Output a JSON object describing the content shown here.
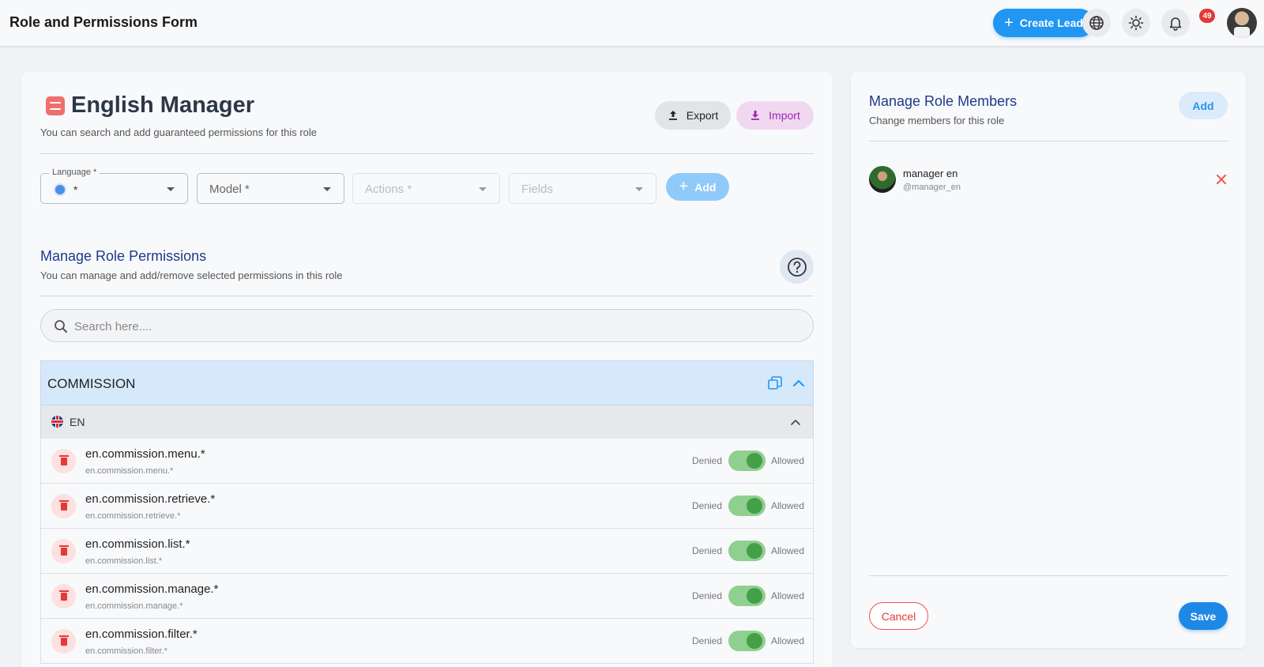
{
  "header": {
    "title": "Role and Permissions Form",
    "create_lead_label": "Create Lead",
    "notification_count": "49"
  },
  "role": {
    "title": "English Manager",
    "subtitle": "You can search and add guaranteed permissions for this role",
    "export_label": "Export",
    "import_label": "Import"
  },
  "filters": {
    "language_label": "Language *",
    "language_value": "*",
    "model_placeholder": "Model *",
    "actions_placeholder": "Actions *",
    "fields_placeholder": "Fields",
    "add_label": "Add"
  },
  "permissions_section": {
    "title": "Manage Role Permissions",
    "subtitle": "You can manage and add/remove selected permissions in this role",
    "search_placeholder": "Search here...."
  },
  "group": {
    "name": "COMMISSION",
    "language": "EN",
    "denied_label": "Denied",
    "allowed_label": "Allowed",
    "items": [
      {
        "name": "en.commission.menu.*",
        "key": "en.commission.menu.*",
        "allowed": true
      },
      {
        "name": "en.commission.retrieve.*",
        "key": "en.commission.retrieve.*",
        "allowed": true
      },
      {
        "name": "en.commission.list.*",
        "key": "en.commission.list.*",
        "allowed": true
      },
      {
        "name": "en.commission.manage.*",
        "key": "en.commission.manage.*",
        "allowed": true
      },
      {
        "name": "en.commission.filter.*",
        "key": "en.commission.filter.*",
        "allowed": true
      }
    ]
  },
  "members": {
    "title": "Manage Role Members",
    "subtitle": "Change members for this role",
    "add_label": "Add",
    "items": [
      {
        "name": "manager en",
        "handle": "@manager_en"
      }
    ],
    "cancel_label": "Cancel",
    "save_label": "Save"
  },
  "colors": {
    "primary": "#2196f3",
    "danger": "#e53935",
    "success": "#43a047",
    "heading": "#1e3a8a",
    "import_accent": "#9c27b0"
  }
}
